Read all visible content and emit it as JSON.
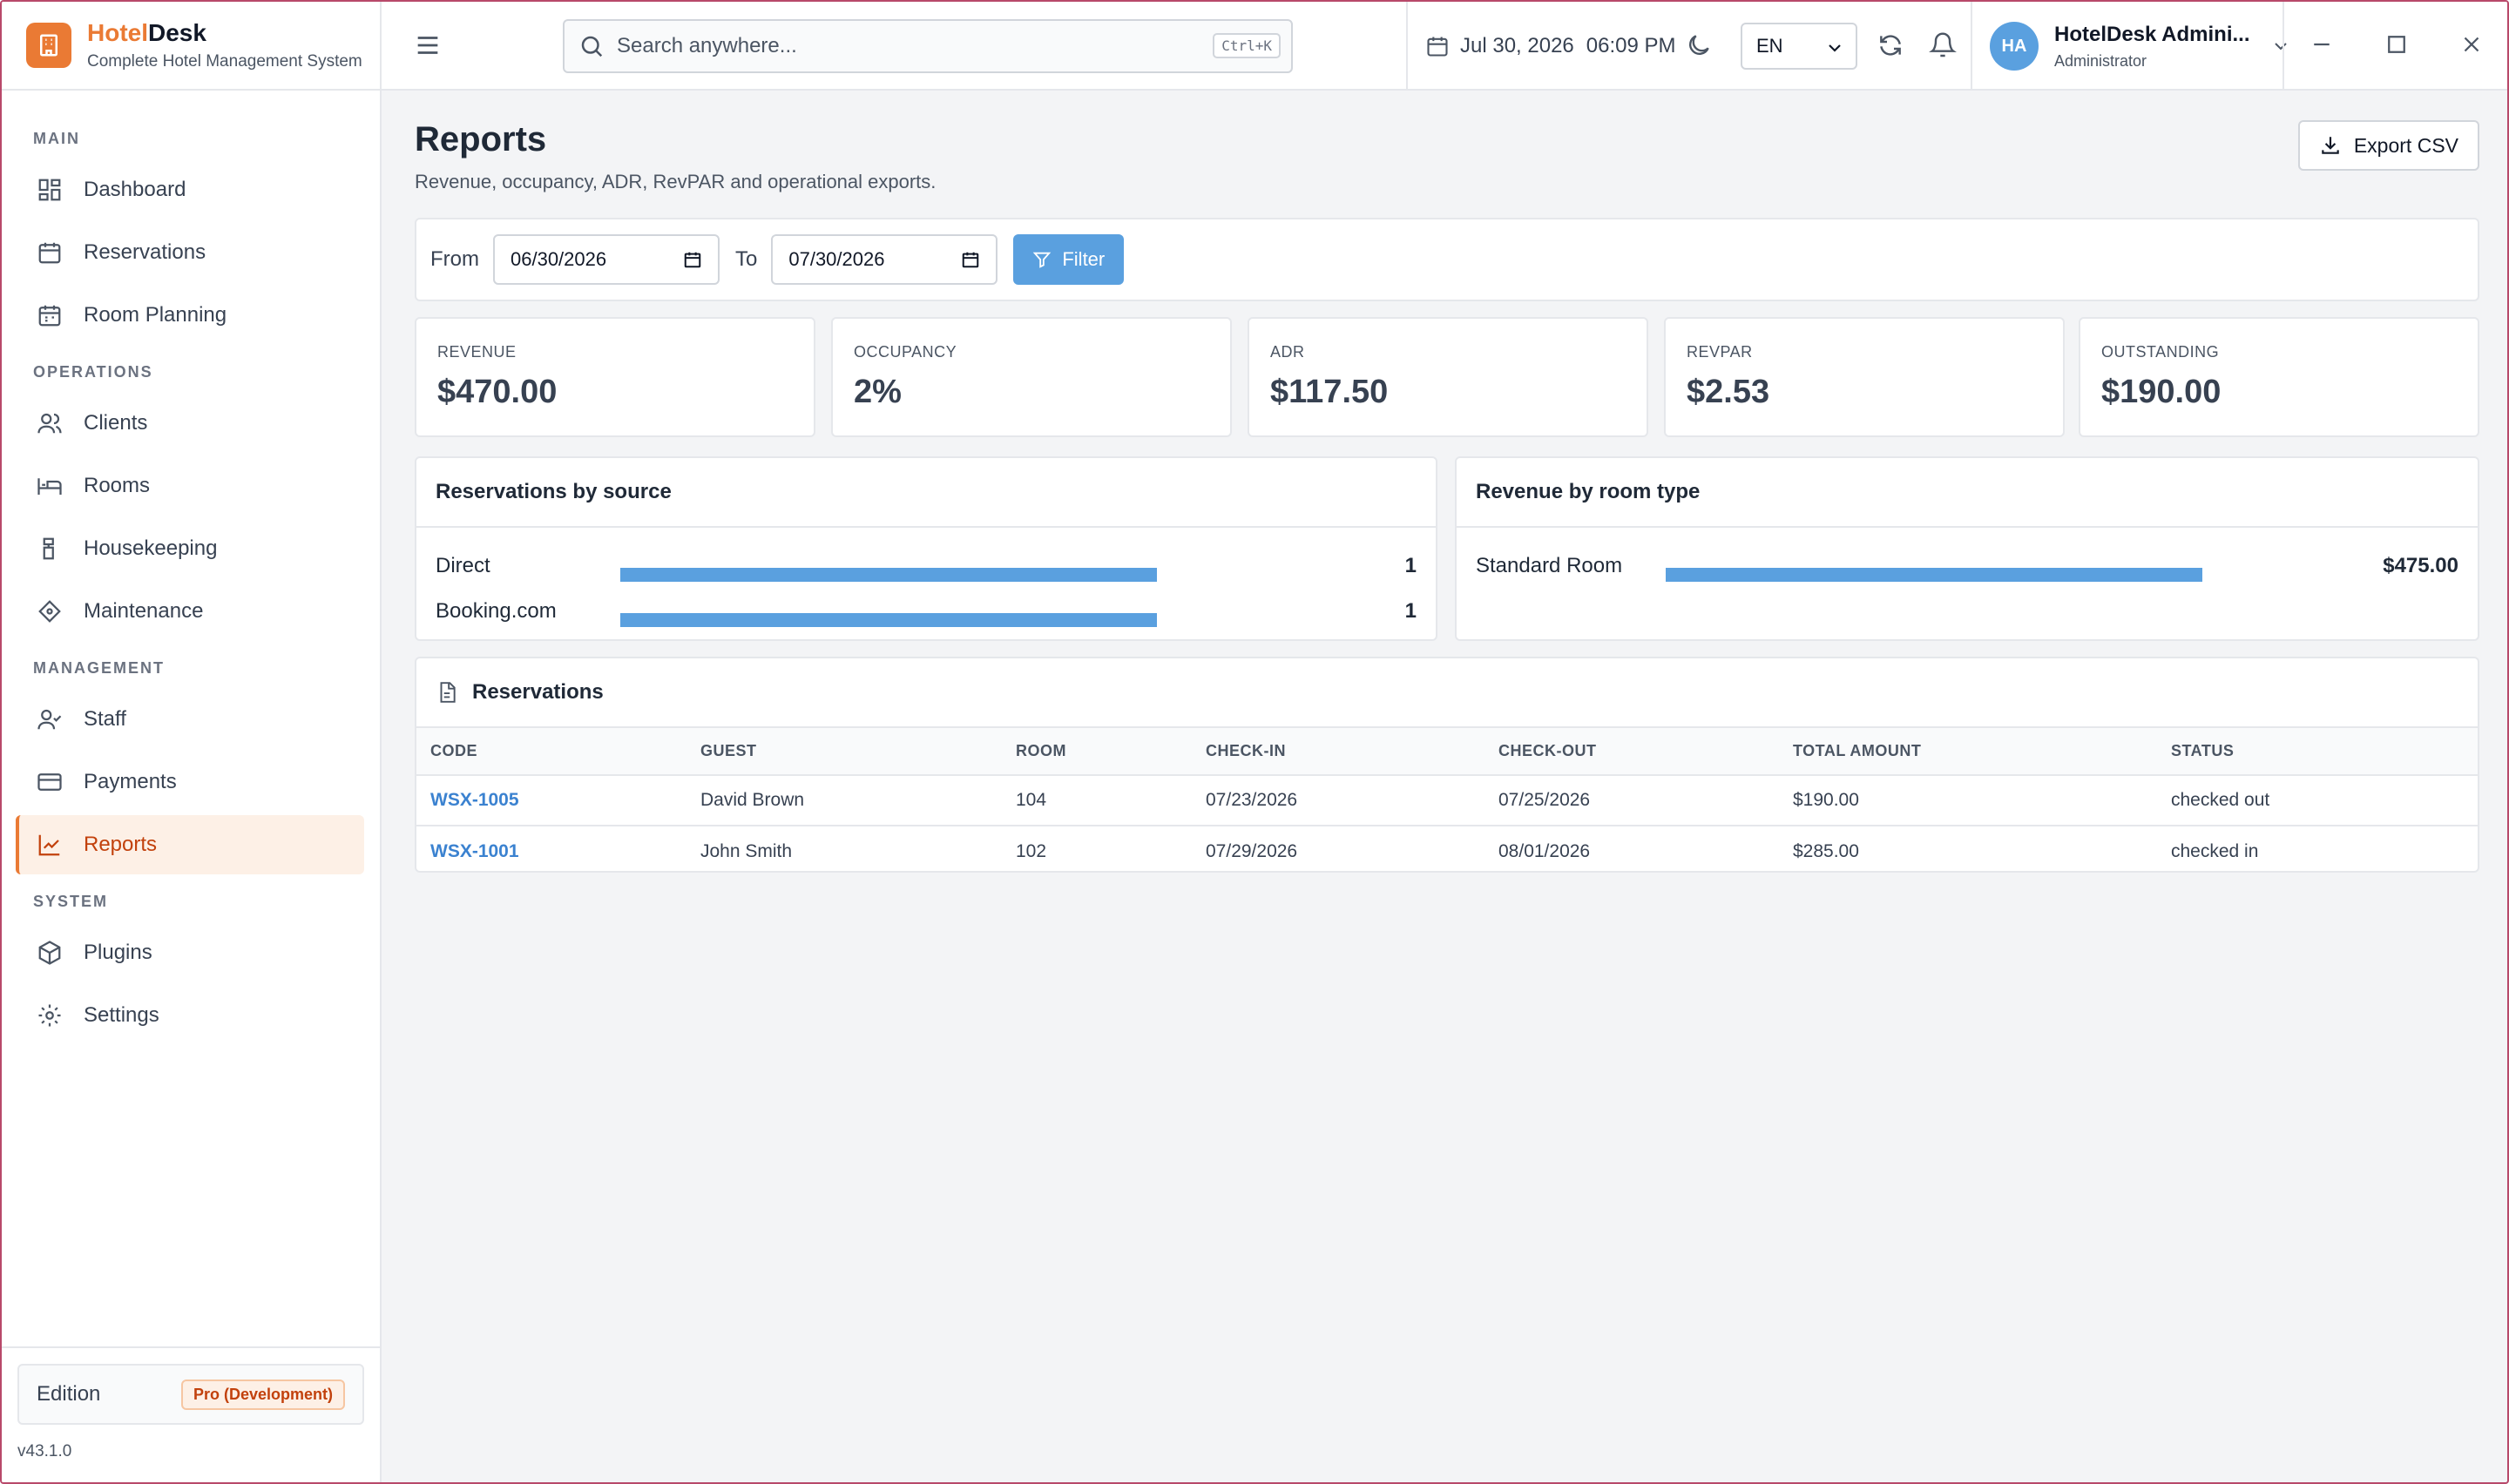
{
  "brand": {
    "name_a": "Hotel",
    "name_b": "Desk",
    "subtitle": "Complete Hotel Management System"
  },
  "sidebar": {
    "sections": [
      {
        "title": "MAIN",
        "items": [
          {
            "label": "Dashboard",
            "icon": "dashboard-icon"
          },
          {
            "label": "Reservations",
            "icon": "calendar-icon"
          },
          {
            "label": "Room Planning",
            "icon": "calendar-grid-icon"
          }
        ]
      },
      {
        "title": "OPERATIONS",
        "items": [
          {
            "label": "Clients",
            "icon": "users-icon"
          },
          {
            "label": "Rooms",
            "icon": "bed-icon"
          },
          {
            "label": "Housekeeping",
            "icon": "housekeeping-icon"
          },
          {
            "label": "Maintenance",
            "icon": "wrench-icon"
          }
        ]
      },
      {
        "title": "MANAGEMENT",
        "items": [
          {
            "label": "Staff",
            "icon": "user-check-icon"
          },
          {
            "label": "Payments",
            "icon": "credit-card-icon"
          },
          {
            "label": "Reports",
            "icon": "chart-line-icon",
            "active": true
          }
        ]
      },
      {
        "title": "SYSTEM",
        "items": [
          {
            "label": "Plugins",
            "icon": "package-icon"
          },
          {
            "label": "Settings",
            "icon": "gear-icon"
          }
        ]
      }
    ],
    "edition_label": "Edition",
    "edition_badge": "Pro (Development)",
    "version": "v43.1.0"
  },
  "topbar": {
    "search_placeholder": "Search anywhere...",
    "search_shortcut": "Ctrl+K",
    "date": "Jul 30, 2026",
    "time": "06:09 PM",
    "language": "EN",
    "user_initials": "HA",
    "user_name": "HotelDesk Admini...",
    "user_role": "Administrator"
  },
  "page": {
    "title": "Reports",
    "subtitle": "Revenue, occupancy, ADR, RevPAR and operational exports.",
    "export_label": "Export CSV"
  },
  "filter": {
    "from_label": "From",
    "from_value": "06/30/2026",
    "to_label": "To",
    "to_value": "07/30/2026",
    "button": "Filter"
  },
  "kpis": [
    {
      "label": "REVENUE",
      "value": "$470.00"
    },
    {
      "label": "OCCUPANCY",
      "value": "2%"
    },
    {
      "label": "ADR",
      "value": "$117.50"
    },
    {
      "label": "REVPAR",
      "value": "$2.53"
    },
    {
      "label": "OUTSTANDING",
      "value": "$190.00"
    }
  ],
  "by_source": {
    "title": "Reservations by source",
    "rows": [
      {
        "label": "Direct",
        "value": "1",
        "fraction": 1.0
      },
      {
        "label": "Booking.com",
        "value": "1",
        "fraction": 1.0
      }
    ]
  },
  "by_room_type": {
    "title": "Revenue by room type",
    "rows": [
      {
        "label": "Standard Room",
        "value": "$475.00",
        "fraction": 1.0
      }
    ]
  },
  "reservations": {
    "title": "Reservations",
    "columns": [
      "CODE",
      "GUEST",
      "ROOM",
      "CHECK-IN",
      "CHECK-OUT",
      "TOTAL AMOUNT",
      "STATUS"
    ],
    "rows": [
      [
        "WSX-1005",
        "David Brown",
        "104",
        "07/23/2026",
        "07/25/2026",
        "$190.00",
        "checked out"
      ],
      [
        "WSX-1001",
        "John Smith",
        "102",
        "07/29/2026",
        "08/01/2026",
        "$285.00",
        "checked in"
      ]
    ]
  },
  "colors": {
    "accent": "#ea7a34",
    "primary": "#5aa0df",
    "link": "#3b82d0"
  }
}
